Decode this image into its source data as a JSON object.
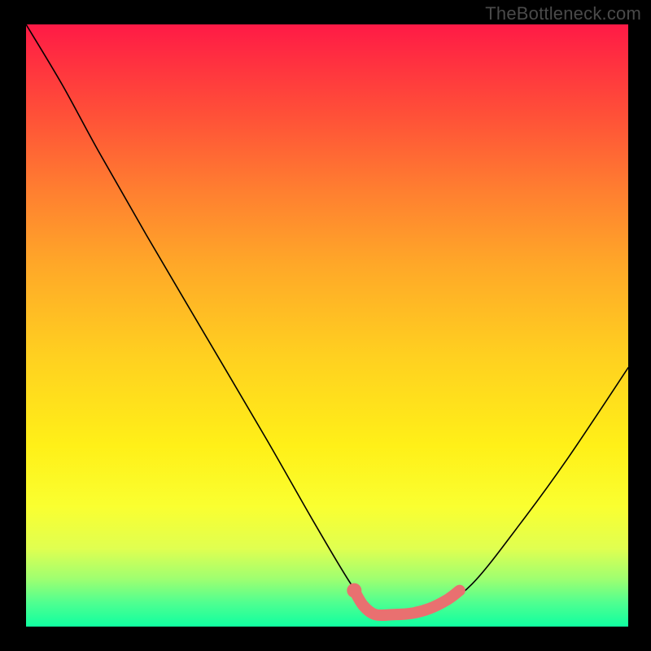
{
  "watermark": "TheBottleneck.com",
  "chart_data": {
    "type": "line",
    "title": "",
    "xlabel": "",
    "ylabel": "",
    "xlim": [
      0,
      1
    ],
    "ylim": [
      0,
      1
    ],
    "series": [
      {
        "name": "bottleneck-curve",
        "x": [
          0.0,
          0.06,
          0.12,
          0.2,
          0.3,
          0.4,
          0.48,
          0.54,
          0.58,
          0.62,
          0.68,
          0.74,
          0.82,
          0.9,
          1.0
        ],
        "values": [
          1.0,
          0.9,
          0.79,
          0.65,
          0.48,
          0.31,
          0.17,
          0.07,
          0.02,
          0.02,
          0.03,
          0.07,
          0.17,
          0.28,
          0.43
        ]
      }
    ],
    "highlight": {
      "name": "optimum-band",
      "color": "#e97070",
      "points": [
        {
          "x": 0.545,
          "y": 0.06
        },
        {
          "x": 0.56,
          "y": 0.035
        },
        {
          "x": 0.58,
          "y": 0.02
        },
        {
          "x": 0.61,
          "y": 0.02
        },
        {
          "x": 0.64,
          "y": 0.022
        },
        {
          "x": 0.67,
          "y": 0.03
        },
        {
          "x": 0.7,
          "y": 0.045
        },
        {
          "x": 0.72,
          "y": 0.06
        }
      ]
    },
    "background_gradient": {
      "top": "#ff1a46",
      "mid": "#ffd020",
      "bottom": "#10ffa0"
    }
  }
}
